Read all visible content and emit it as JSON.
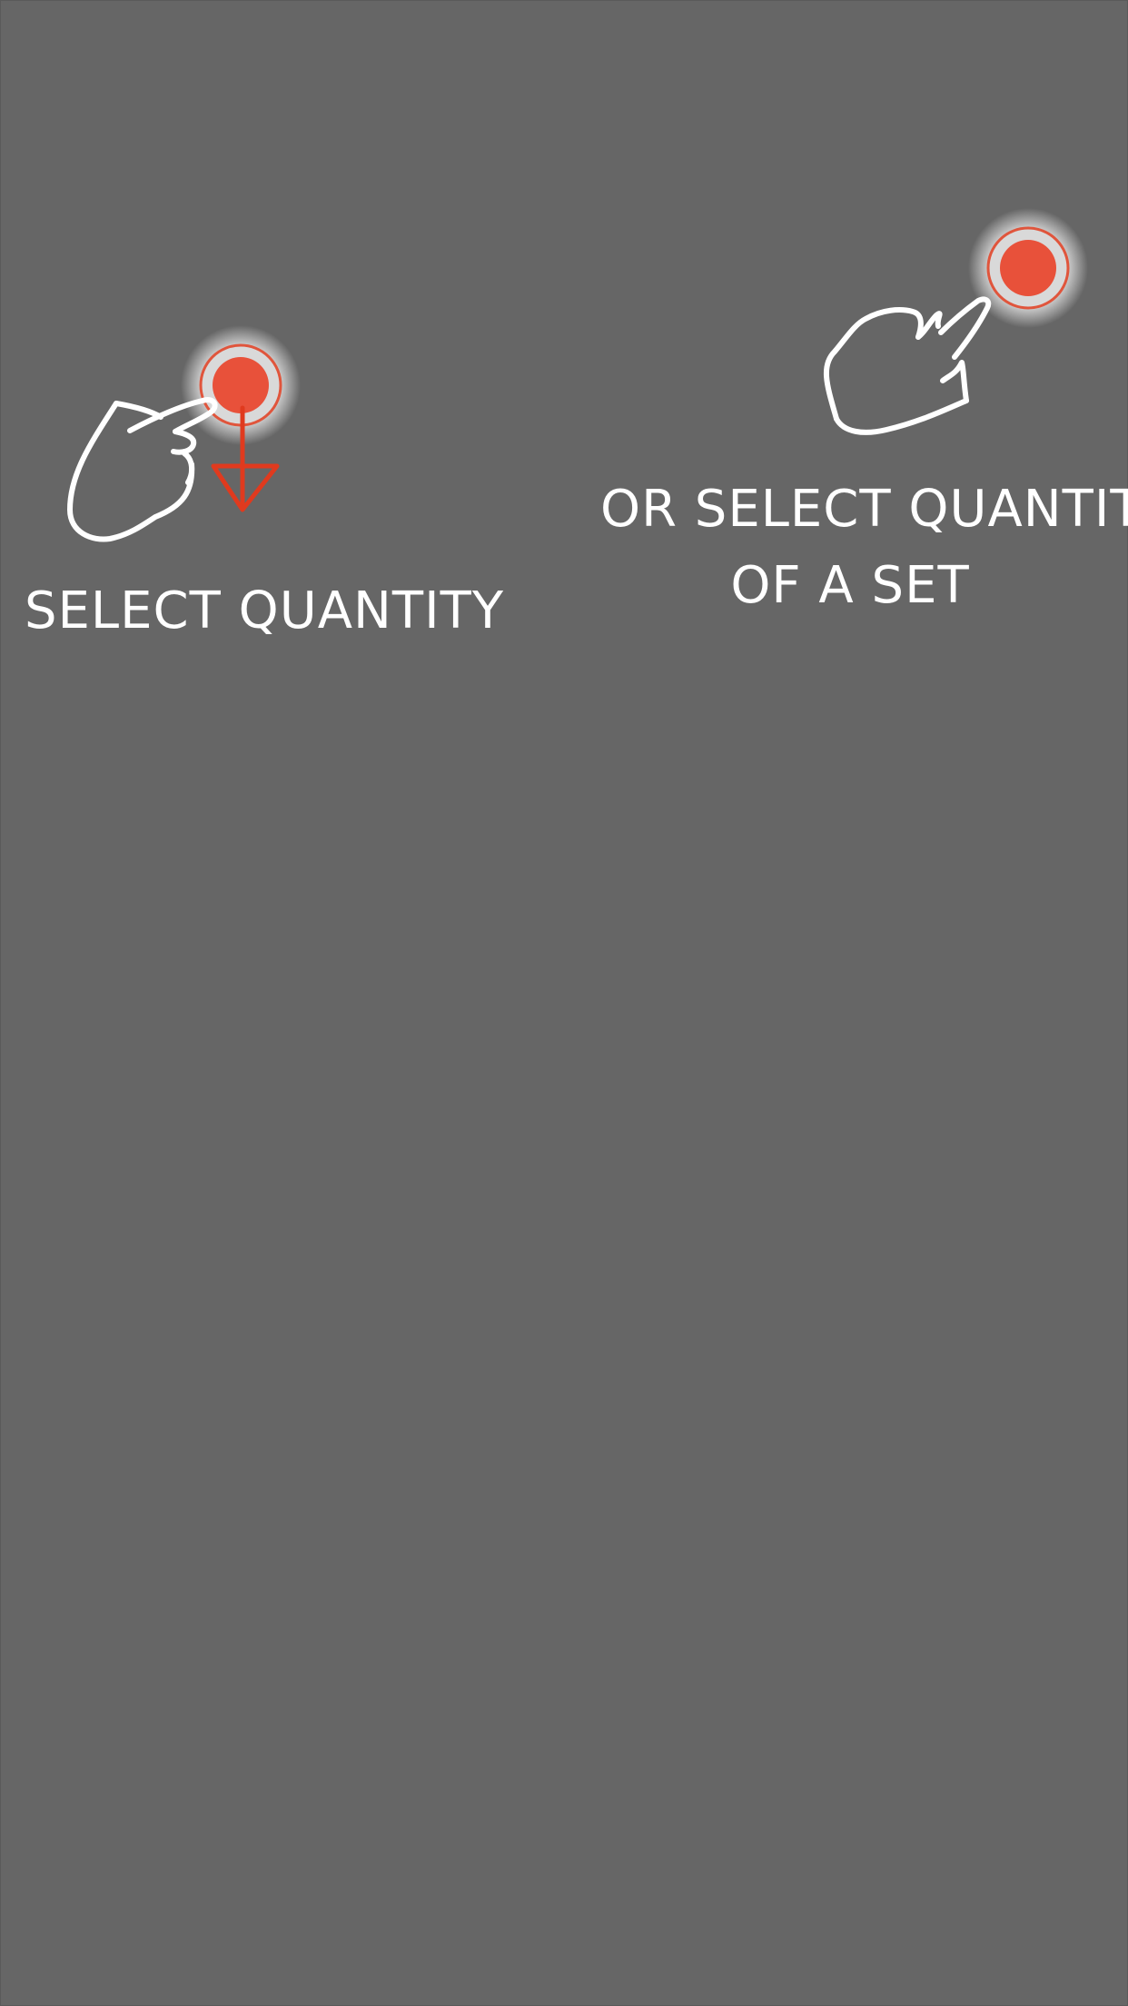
{
  "tutorial": {
    "select_quantity": {
      "caption": "SELECT QUANTITY",
      "hand_icon": "pointing-hand-icon",
      "gesture": "tap-and-drag-down"
    },
    "select_set": {
      "caption_line1": "OR SELECT QUANTITY",
      "caption_line2": "OF A SET",
      "hand_icon": "pointing-hand-icon",
      "gesture": "tap"
    }
  },
  "colors": {
    "overlay": "#666666",
    "tap_dot": "#e8513a",
    "tap_ring": "#d9d9d9",
    "arrow": "#e03a1e",
    "stroke": "#ffffff"
  }
}
